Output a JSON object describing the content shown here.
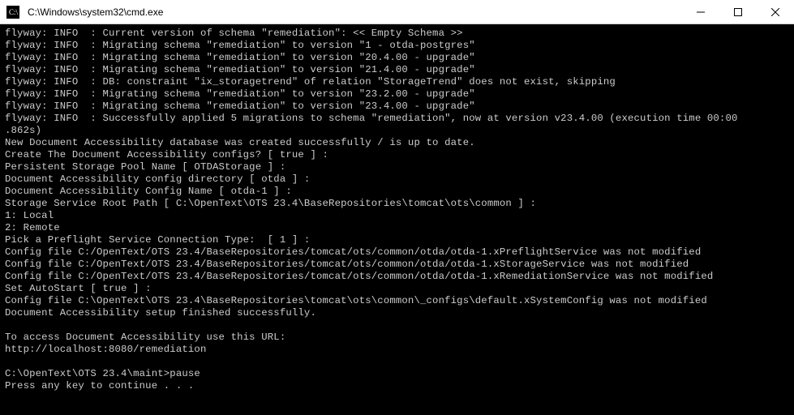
{
  "window": {
    "icon": "cmd-icon",
    "title": "C:\\Windows\\system32\\cmd.exe"
  },
  "terminal": {
    "lines": [
      "flyway: INFO  : Current version of schema \"remediation\": << Empty Schema >>",
      "flyway: INFO  : Migrating schema \"remediation\" to version \"1 - otda-postgres\"",
      "flyway: INFO  : Migrating schema \"remediation\" to version \"20.4.00 - upgrade\"",
      "flyway: INFO  : Migrating schema \"remediation\" to version \"21.4.00 - upgrade\"",
      "flyway: INFO  : DB: constraint \"ix_storagetrend\" of relation \"StorageTrend\" does not exist, skipping",
      "flyway: INFO  : Migrating schema \"remediation\" to version \"23.2.00 - upgrade\"",
      "flyway: INFO  : Migrating schema \"remediation\" to version \"23.4.00 - upgrade\"",
      "flyway: INFO  : Successfully applied 5 migrations to schema \"remediation\", now at version v23.4.00 (execution time 00:00",
      ".862s)",
      "New Document Accessibility database was created successfully / is up to date.",
      "Create The Document Accessibility configs? [ true ] :",
      "Persistent Storage Pool Name [ OTDAStorage ] :",
      "Document Accessibility config directory [ otda ] :",
      "Document Accessibility Config Name [ otda-1 ] :",
      "Storage Service Root Path [ C:\\OpenText\\OTS 23.4\\BaseRepositories\\tomcat\\ots\\common ] :",
      "1: Local",
      "2: Remote",
      "Pick a Preflight Service Connection Type:  [ 1 ] :",
      "Config file C:/OpenText/OTS 23.4/BaseRepositories/tomcat/ots/common/otda/otda-1.xPreflightService was not modified",
      "Config file C:/OpenText/OTS 23.4/BaseRepositories/tomcat/ots/common/otda/otda-1.xStorageService was not modified",
      "Config file C:/OpenText/OTS 23.4/BaseRepositories/tomcat/ots/common/otda/otda-1.xRemediationService was not modified",
      "Set AutoStart [ true ] :",
      "Config file C:\\OpenText\\OTS 23.4\\BaseRepositories\\tomcat\\ots\\common\\_configs\\default.xSystemConfig was not modified",
      "Document Accessibility setup finished successfully.",
      "",
      "To access Document Accessibility use this URL:",
      "http://localhost:8080/remediation",
      "",
      "C:\\OpenText\\OTS 23.4\\maint>pause",
      "Press any key to continue . . ."
    ]
  }
}
